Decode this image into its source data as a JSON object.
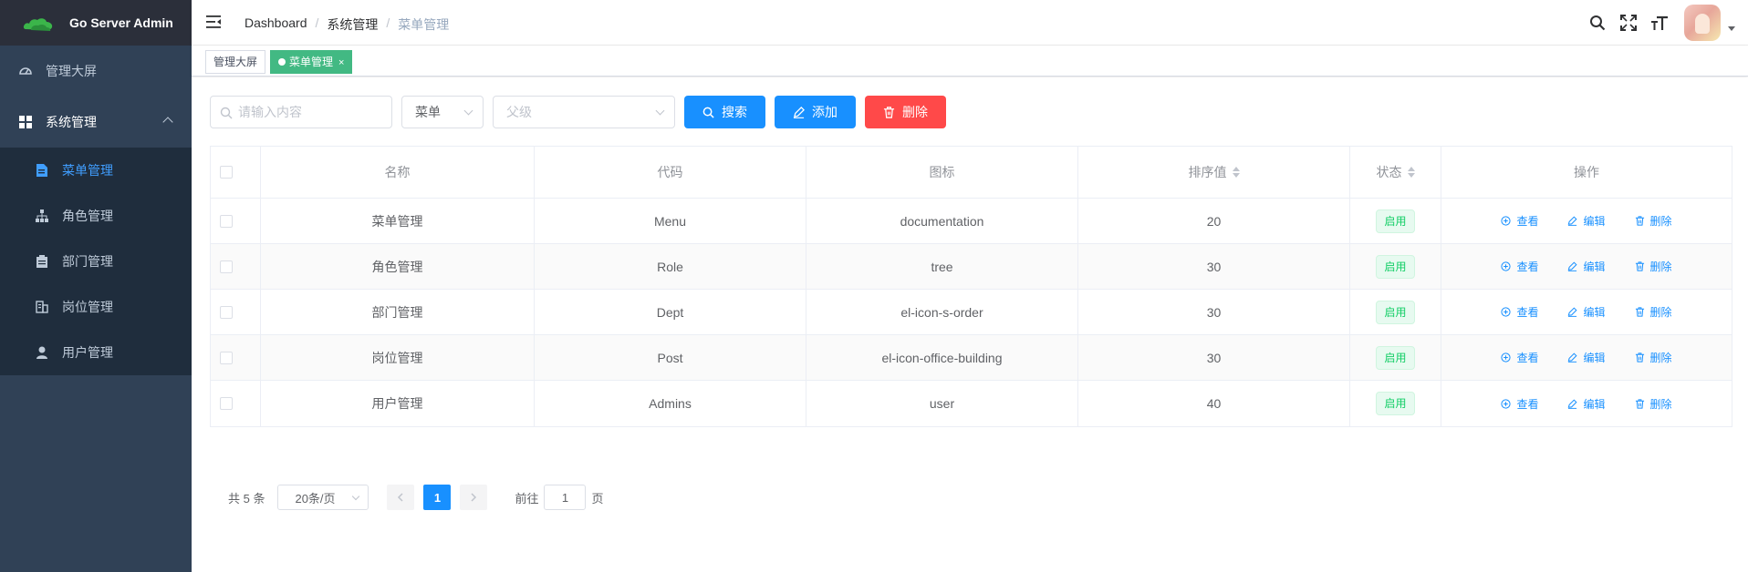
{
  "app": {
    "title": "Go Server Admin"
  },
  "sidebar": {
    "items": [
      {
        "label": "管理大屏",
        "icon": "dashboard-icon"
      },
      {
        "label": "系统管理",
        "icon": "grid-icon"
      }
    ],
    "submenu": [
      {
        "label": "菜单管理",
        "icon": "document-icon",
        "active": true
      },
      {
        "label": "角色管理",
        "icon": "tree-icon"
      },
      {
        "label": "部门管理",
        "icon": "clipboard-icon"
      },
      {
        "label": "岗位管理",
        "icon": "building-icon"
      },
      {
        "label": "用户管理",
        "icon": "user-icon"
      }
    ]
  },
  "navbar": {
    "breadcrumb": [
      "Dashboard",
      "系统管理",
      "菜单管理"
    ],
    "separator": "/"
  },
  "tags": [
    {
      "label": "管理大屏"
    },
    {
      "label": "菜单管理",
      "active": true,
      "close": "×"
    }
  ],
  "toolbar": {
    "search_placeholder": "请输入内容",
    "type_select": "菜单",
    "parent_placeholder": "父级",
    "search_label": "搜索",
    "add_label": "添加",
    "delete_label": "删除"
  },
  "table": {
    "columns": [
      "名称",
      "代码",
      "图标",
      "排序值",
      "状态",
      "操作"
    ],
    "rows": [
      {
        "name": "菜单管理",
        "code": "Menu",
        "icon": "documentation",
        "sort": "20",
        "status": "启用"
      },
      {
        "name": "角色管理",
        "code": "Role",
        "icon": "tree",
        "sort": "30",
        "status": "启用"
      },
      {
        "name": "部门管理",
        "code": "Dept",
        "icon": "el-icon-s-order",
        "sort": "30",
        "status": "启用"
      },
      {
        "name": "岗位管理",
        "code": "Post",
        "icon": "el-icon-office-building",
        "sort": "30",
        "status": "启用"
      },
      {
        "name": "用户管理",
        "code": "Admins",
        "icon": "user",
        "sort": "40",
        "status": "启用"
      }
    ],
    "ops": {
      "view": "查看",
      "edit": "编辑",
      "delete": "删除"
    }
  },
  "pagination": {
    "total": "共 5 条",
    "page_size": "20条/页",
    "current": "1",
    "goto": "前往",
    "goto_value": "1",
    "page_suffix": "页"
  },
  "colors": {
    "primary": "#1890ff",
    "danger": "#ff4949",
    "success": "#13ce66",
    "sidebar": "#304156",
    "tag_active": "#42b983"
  }
}
